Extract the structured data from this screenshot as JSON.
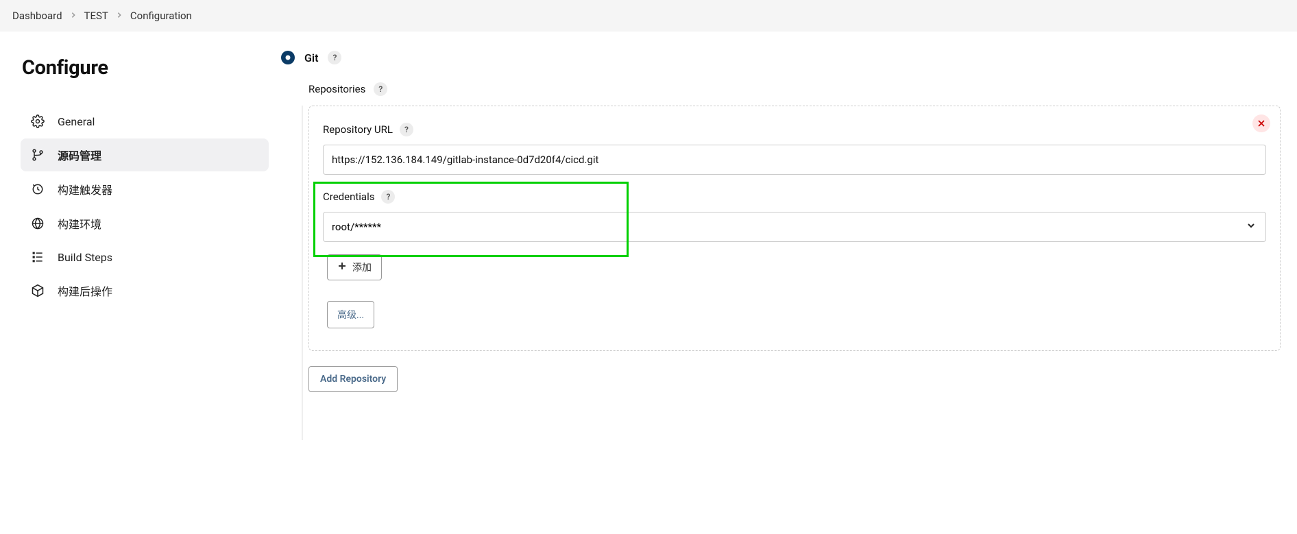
{
  "breadcrumb": {
    "items": [
      "Dashboard",
      "TEST",
      "Configuration"
    ]
  },
  "page": {
    "title": "Configure"
  },
  "sidebar": {
    "items": [
      {
        "label": "General"
      },
      {
        "label": "源码管理"
      },
      {
        "label": "构建触发器"
      },
      {
        "label": "构建环境"
      },
      {
        "label": "Build Steps"
      },
      {
        "label": "构建后操作"
      }
    ]
  },
  "scm": {
    "git_label": "Git",
    "repositories_label": "Repositories",
    "repo_url_label": "Repository URL",
    "repo_url_value": "https://152.136.184.149/gitlab-instance-0d7d20f4/cicd.git",
    "credentials_label": "Credentials",
    "credentials_value": "root/******",
    "add_label": "添加",
    "advanced_label": "高级...",
    "add_repository_label": "Add Repository"
  }
}
